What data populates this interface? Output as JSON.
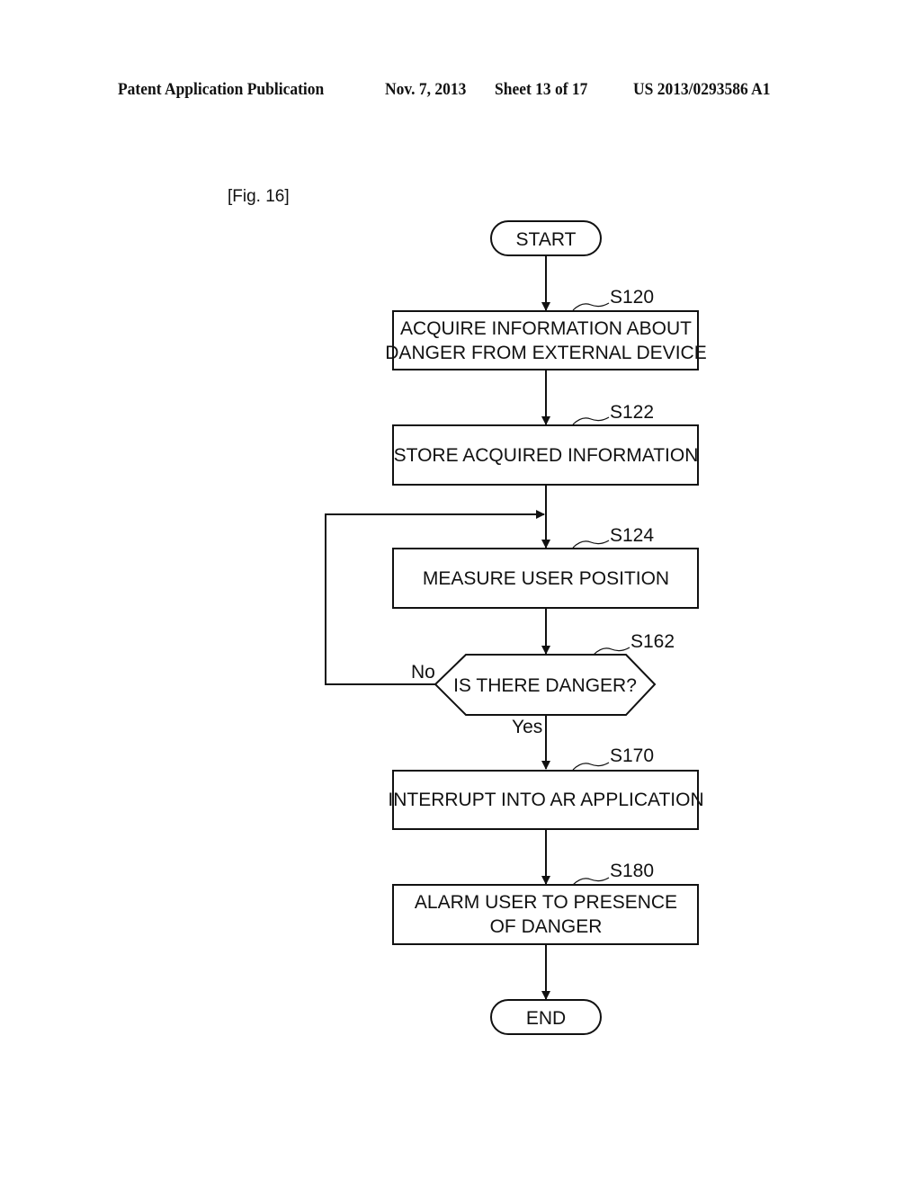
{
  "header": {
    "publication": "Patent Application Publication",
    "date": "Nov. 7, 2013",
    "sheet": "Sheet 13 of 17",
    "number": "US 2013/0293586 A1"
  },
  "figure": {
    "label": "[Fig. 16]",
    "start": "START",
    "end": "END",
    "steps": [
      {
        "id": "S120",
        "lines": [
          "ACQUIRE INFORMATION ABOUT",
          "DANGER FROM EXTERNAL DEVICE"
        ]
      },
      {
        "id": "S122",
        "lines": [
          "STORE ACQUIRED INFORMATION"
        ]
      },
      {
        "id": "S124",
        "lines": [
          "MEASURE USER POSITION"
        ]
      },
      {
        "id": "S162",
        "lines": [
          "IS THERE DANGER?"
        ]
      },
      {
        "id": "S170",
        "lines": [
          "INTERRUPT INTO AR APPLICATION"
        ]
      },
      {
        "id": "S180",
        "lines": [
          "ALARM USER TO PRESENCE",
          "OF DANGER"
        ]
      }
    ],
    "branch_no": "No",
    "branch_yes": "Yes"
  }
}
